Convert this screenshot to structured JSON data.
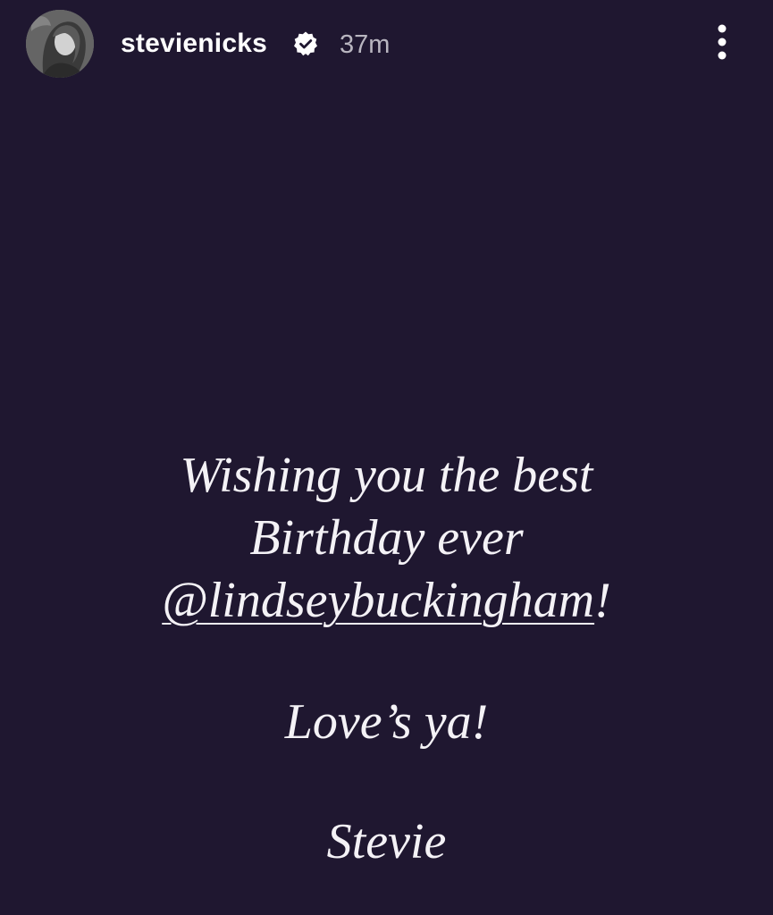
{
  "story": {
    "background_color": "#1f1730",
    "header": {
      "username": "stevienicks",
      "verified": true,
      "timestamp": "37m",
      "icons": {
        "avatar": "profile-photo",
        "verified": "verified-badge-icon",
        "more": "more-vertical-icon"
      }
    },
    "message": {
      "line1": "Wishing you the best",
      "line2": "Birthday ever",
      "mention": "@lindseybuckingham",
      "mention_suffix": "!",
      "line4": "Love’s ya!",
      "signature": "Stevie"
    }
  }
}
